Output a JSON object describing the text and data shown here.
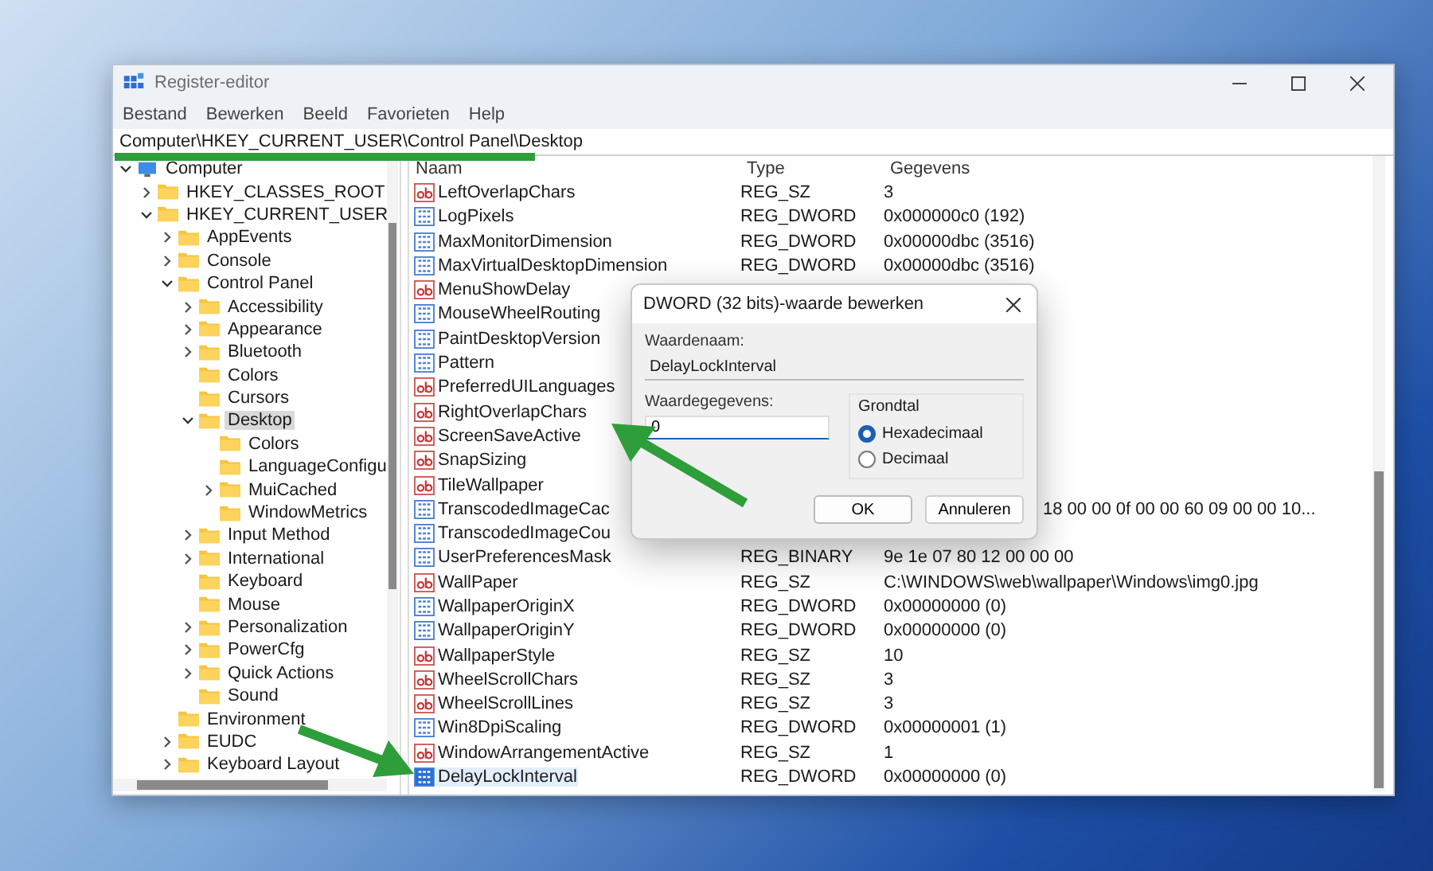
{
  "window": {
    "title": "Register-editor"
  },
  "menu": [
    "Bestand",
    "Bewerken",
    "Beeld",
    "Favorieten",
    "Help"
  ],
  "address": "Computer\\HKEY_CURRENT_USER\\Control Panel\\Desktop",
  "tree": [
    {
      "label": "Computer",
      "kind": "computer",
      "expanded": true,
      "selected": false,
      "children": [
        {
          "label": "HKEY_CLASSES_ROOT",
          "kind": "folder",
          "expanded": false,
          "selected": false
        },
        {
          "label": "HKEY_CURRENT_USER",
          "kind": "folder",
          "expanded": true,
          "selected": false,
          "children": [
            {
              "label": "AppEvents",
              "kind": "folder",
              "expanded": false,
              "selected": false
            },
            {
              "label": "Console",
              "kind": "folder",
              "expanded": false,
              "selected": false
            },
            {
              "label": "Control Panel",
              "kind": "folder",
              "expanded": true,
              "selected": false,
              "children": [
                {
                  "label": "Accessibility",
                  "kind": "folder",
                  "expanded": false,
                  "selected": false
                },
                {
                  "label": "Appearance",
                  "kind": "folder",
                  "expanded": false,
                  "selected": false
                },
                {
                  "label": "Bluetooth",
                  "kind": "folder",
                  "expanded": false,
                  "selected": false
                },
                {
                  "label": "Colors",
                  "kind": "folder",
                  "selected": false
                },
                {
                  "label": "Cursors",
                  "kind": "folder",
                  "selected": false
                },
                {
                  "label": "Desktop",
                  "kind": "folder",
                  "expanded": true,
                  "selected": true,
                  "children": [
                    {
                      "label": "Colors",
                      "kind": "folder",
                      "selected": false
                    },
                    {
                      "label": "LanguageConfigu",
                      "kind": "folder",
                      "selected": false
                    },
                    {
                      "label": "MuiCached",
                      "kind": "folder",
                      "expanded": false,
                      "selected": false
                    },
                    {
                      "label": "WindowMetrics",
                      "kind": "folder",
                      "selected": false
                    }
                  ]
                },
                {
                  "label": "Input Method",
                  "kind": "folder",
                  "expanded": false,
                  "selected": false
                },
                {
                  "label": "International",
                  "kind": "folder",
                  "expanded": false,
                  "selected": false
                },
                {
                  "label": "Keyboard",
                  "kind": "folder",
                  "selected": false
                },
                {
                  "label": "Mouse",
                  "kind": "folder",
                  "selected": false
                },
                {
                  "label": "Personalization",
                  "kind": "folder",
                  "expanded": false,
                  "selected": false
                },
                {
                  "label": "PowerCfg",
                  "kind": "folder",
                  "expanded": false,
                  "selected": false
                },
                {
                  "label": "Quick Actions",
                  "kind": "folder",
                  "expanded": false,
                  "selected": false
                },
                {
                  "label": "Sound",
                  "kind": "folder",
                  "selected": false
                }
              ]
            },
            {
              "label": "Environment",
              "kind": "folder",
              "selected": false
            },
            {
              "label": "EUDC",
              "kind": "folder",
              "expanded": false,
              "selected": false
            },
            {
              "label": "Keyboard Layout",
              "kind": "folder",
              "expanded": false,
              "selected": false
            }
          ]
        }
      ]
    }
  ],
  "table": {
    "columns": [
      "Naam",
      "Type",
      "Gegevens"
    ],
    "rows": [
      {
        "name": "LeftOverlapChars",
        "type": "REG_SZ",
        "data": "3",
        "kind": "string",
        "selected": false
      },
      {
        "name": "LogPixels",
        "type": "REG_DWORD",
        "data": "0x000000c0 (192)",
        "kind": "binary",
        "selected": false
      },
      {
        "name": "MaxMonitorDimension",
        "type": "REG_DWORD",
        "data": "0x00000dbc (3516)",
        "kind": "binary",
        "selected": false
      },
      {
        "name": "MaxVirtualDesktopDimension",
        "type": "REG_DWORD",
        "data": "0x00000dbc (3516)",
        "kind": "binary",
        "selected": false
      },
      {
        "name": "MenuShowDelay",
        "kind": "string",
        "selected": false
      },
      {
        "name": "MouseWheelRouting",
        "kind": "binary",
        "selected": false
      },
      {
        "name": "PaintDesktopVersion",
        "kind": "binary",
        "selected": false
      },
      {
        "name": "Pattern",
        "kind": "binary",
        "selected": false
      },
      {
        "name": "PreferredUILanguages",
        "kind": "string",
        "selected": false
      },
      {
        "name": "RightOverlapChars",
        "kind": "string",
        "selected": false
      },
      {
        "name": "ScreenSaveActive",
        "kind": "string",
        "selected": false
      },
      {
        "name": "SnapSizing",
        "kind": "string",
        "selected": false
      },
      {
        "name": "TileWallpaper",
        "kind": "string",
        "selected": false
      },
      {
        "name": "TranscodedImageCac",
        "data": "18 00 00 0f 00 00 60 09 00 00 10...",
        "kind": "binary",
        "selected": false
      },
      {
        "name": "TranscodedImageCou",
        "kind": "binary",
        "selected": false
      },
      {
        "name": "UserPreferencesMask",
        "type": "REG_BINARY",
        "data": "9e 1e 07 80 12 00 00 00",
        "kind": "binary",
        "selected": false
      },
      {
        "name": "WallPaper",
        "type": "REG_SZ",
        "data": "C:\\WINDOWS\\web\\wallpaper\\Windows\\img0.jpg",
        "kind": "string",
        "selected": false
      },
      {
        "name": "WallpaperOriginX",
        "type": "REG_DWORD",
        "data": "0x00000000 (0)",
        "kind": "binary",
        "selected": false
      },
      {
        "name": "WallpaperOriginY",
        "type": "REG_DWORD",
        "data": "0x00000000 (0)",
        "kind": "binary",
        "selected": false
      },
      {
        "name": "WallpaperStyle",
        "type": "REG_SZ",
        "data": "10",
        "kind": "string",
        "selected": false
      },
      {
        "name": "WheelScrollChars",
        "type": "REG_SZ",
        "data": "3",
        "kind": "string",
        "selected": false
      },
      {
        "name": "WheelScrollLines",
        "type": "REG_SZ",
        "data": "3",
        "kind": "string",
        "selected": false
      },
      {
        "name": "Win8DpiScaling",
        "type": "REG_DWORD",
        "data": "0x00000001 (1)",
        "kind": "binary",
        "selected": false
      },
      {
        "name": "WindowArrangementActive",
        "type": "REG_SZ",
        "data": "1",
        "kind": "string",
        "selected": false
      },
      {
        "name": "DelayLockInterval",
        "type": "REG_DWORD",
        "data": "0x00000000 (0)",
        "kind": "binary",
        "selected": true
      }
    ]
  },
  "dialog": {
    "title": "DWORD (32 bits)-waarde bewerken",
    "name_label": "Waardenaam:",
    "name_value": "DelayLockInterval",
    "data_label": "Waardegegevens:",
    "data_value": "0",
    "base_label": "Grondtal",
    "radios": [
      {
        "label": "Hexadecimaal",
        "selected": true
      },
      {
        "label": "Decimaal",
        "selected": false
      }
    ],
    "buttons": [
      {
        "label": "OK",
        "kind": "primary"
      },
      {
        "label": "Annuleren",
        "kind": "secondary"
      }
    ]
  }
}
